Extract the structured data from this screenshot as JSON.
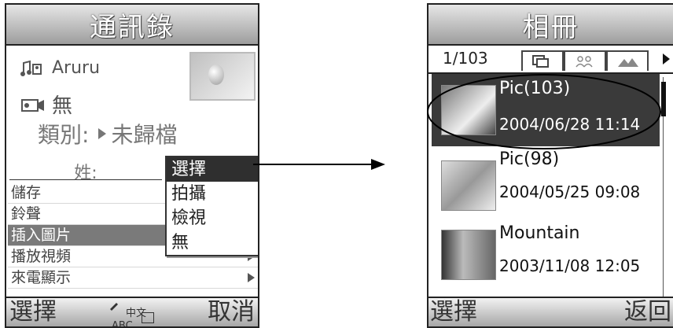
{
  "left": {
    "title": "通訊錄",
    "contact_name": "Aruru",
    "video_value": "無",
    "category_label": "類別:",
    "category_value": "未歸檔",
    "surname_label": "姓:",
    "menu_items": [
      {
        "label": "儲存",
        "selected": false,
        "has_submenu": false
      },
      {
        "label": "鈴聲",
        "selected": false,
        "has_submenu": false
      },
      {
        "label": "插入圖片",
        "selected": true,
        "has_submenu": false
      },
      {
        "label": "播放視頻",
        "selected": false,
        "has_submenu": true
      },
      {
        "label": "來電顯示",
        "selected": false,
        "has_submenu": true
      }
    ],
    "popup_options": [
      {
        "label": "選擇",
        "selected": true
      },
      {
        "label": "拍攝",
        "selected": false
      },
      {
        "label": "檢視",
        "selected": false
      },
      {
        "label": "無",
        "selected": false
      }
    ],
    "softkey_left": "選擇",
    "softkey_right": "取消",
    "input_mode": {
      "top": "中文",
      "bottom": "ABC"
    }
  },
  "right": {
    "title": "相冊",
    "counter": "1/103",
    "items": [
      {
        "title": "Pic(103)",
        "date": "2004/06/28 11:14",
        "selected": true
      },
      {
        "title": "Pic(98)",
        "date": "2004/05/25 09:08",
        "selected": false
      },
      {
        "title": "Mountain",
        "date": "2003/11/08 12:05",
        "selected": false
      }
    ],
    "softkey_left": "選擇",
    "softkey_right": "返回"
  },
  "icons": {
    "ringtone": "music-note-icon",
    "video": "video-camera-icon",
    "tabs": [
      "all-photos-icon",
      "people-icon",
      "landscape-icon"
    ]
  },
  "colors": {
    "selection_dark": "#2f2f2f",
    "selection_mid": "#7a7a7a",
    "titlebar": "#9d9d9d"
  }
}
